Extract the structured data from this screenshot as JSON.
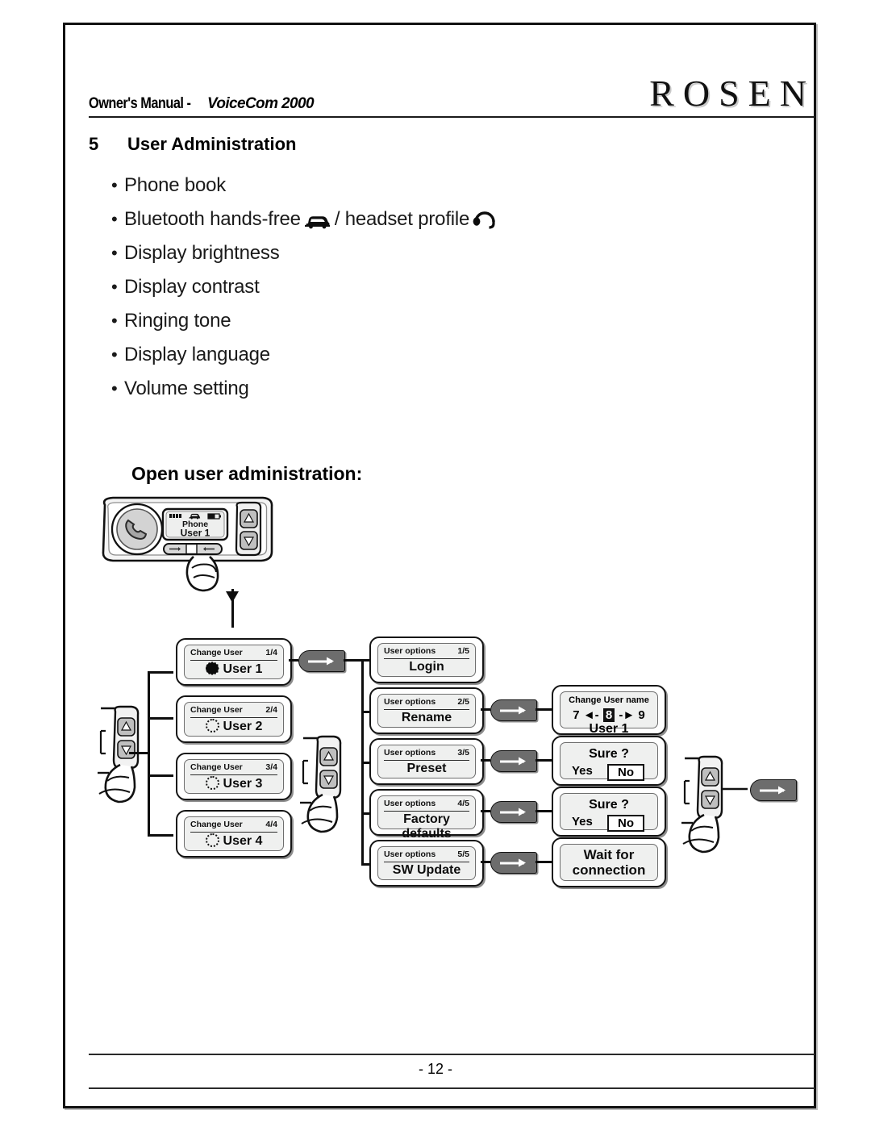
{
  "header": {
    "manual_label": "Owner's Manual - ",
    "product": "VoiceCom 2000",
    "brand": "ROSEN"
  },
  "section": {
    "number": "5",
    "title": "User Administration"
  },
  "bullets": [
    {
      "text": "Phone book",
      "icons": []
    },
    {
      "text_before": "Bluetooth hands-free",
      "icon1": "car-icon",
      "text_mid": "/ headset profile",
      "icon2": "headset-icon"
    },
    {
      "text": "Display brightness",
      "icons": []
    },
    {
      "text": "Display contrast",
      "icons": []
    },
    {
      "text": "Ringing tone",
      "icons": []
    },
    {
      "text": "Display language",
      "icons": []
    },
    {
      "text": "Volume setting",
      "icons": []
    }
  ],
  "bullet_labels": {
    "b0": "Phone book",
    "b1a": "Bluetooth hands-free",
    "b1b": "/ headset profile",
    "b2": "Display brightness",
    "b3": "Display contrast",
    "b4": "Ringing tone",
    "b5": "Display language",
    "b6": "Volume setting",
    "marker": "•"
  },
  "diagram": {
    "title": "Open user administration:",
    "device": {
      "display_line1": "Phone",
      "display_line2": "User 1",
      "signal_icon": "signal-bars-icon",
      "car_icon": "car-icon",
      "battery_icon": "battery-icon",
      "call_button_icon": "phone-handset-icon",
      "up_icon": "triangle-up-icon",
      "down_icon": "triangle-down-icon"
    },
    "change_user": [
      {
        "head_left": "Change User",
        "head_right": "1/4",
        "label": "User 1",
        "marker": "selected"
      },
      {
        "head_left": "Change User",
        "head_right": "2/4",
        "label": "User 2",
        "marker": "unselected"
      },
      {
        "head_left": "Change User",
        "head_right": "3/4",
        "label": "User 3",
        "marker": "unselected"
      },
      {
        "head_left": "Change User",
        "head_right": "4/4",
        "label": "User 4",
        "marker": "unselected"
      }
    ],
    "user_options": [
      {
        "head_left": "User options",
        "head_right": "1/5",
        "label": "Login"
      },
      {
        "head_left": "User options",
        "head_right": "2/5",
        "label": "Rename"
      },
      {
        "head_left": "User options",
        "head_right": "3/5",
        "label": "Preset"
      },
      {
        "head_left": "User options",
        "head_right": "4/5",
        "label": "Factory defaults"
      },
      {
        "head_left": "User options",
        "head_right": "5/5",
        "label": "SW Update"
      }
    ],
    "results": {
      "change_user_name": {
        "title": "Change User name",
        "digit_left": "7",
        "digit_center": "8",
        "digit_right": "9",
        "arrow_left": "◄-",
        "arrow_right": "-►",
        "sub": "User 1"
      },
      "sure_1": {
        "title": "Sure ?",
        "yes": "Yes",
        "no": "No"
      },
      "sure_2": {
        "title": "Sure  ?",
        "yes": "Yes",
        "no": "No"
      },
      "wait": {
        "line1": "Wait for",
        "line2": "connection"
      }
    },
    "arrow_button_icon": "arrow-right-icon"
  },
  "footer": {
    "page_number": "- 12 -"
  },
  "colors": {
    "ink": "#111111",
    "lcd_bg": "#eff0ef",
    "button_gray": "#6d6d6d",
    "shadow": "#8d8d8d"
  }
}
